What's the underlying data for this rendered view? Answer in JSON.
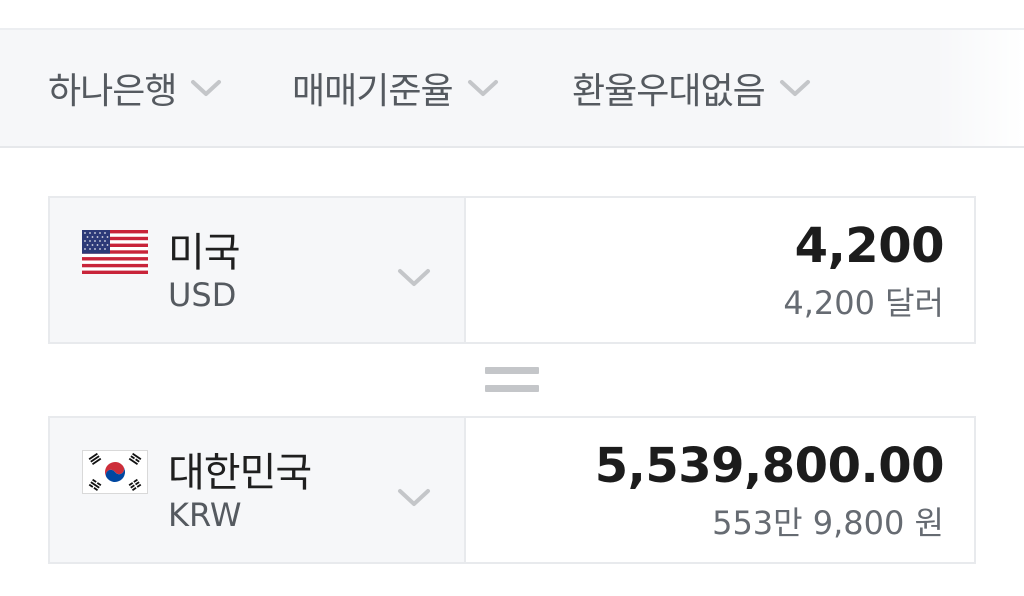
{
  "filters": [
    {
      "label": "하나은행"
    },
    {
      "label": "매매기준율"
    },
    {
      "label": "환율우대없음"
    }
  ],
  "from": {
    "country": "미국",
    "code": "USD",
    "flag": "us-flag",
    "amount": "4,200",
    "amount_text": "4,200 달러"
  },
  "to": {
    "country": "대한민국",
    "code": "KRW",
    "flag": "kr-flag",
    "amount": "5,539,800.00",
    "amount_text": "553만 9,800 원"
  },
  "colors": {
    "panel_bg": "#f6f7f9",
    "border": "#e8eaed",
    "chevron": "#c4c6c9",
    "text_primary": "#1c1c1c",
    "text_secondary": "#666b72"
  }
}
